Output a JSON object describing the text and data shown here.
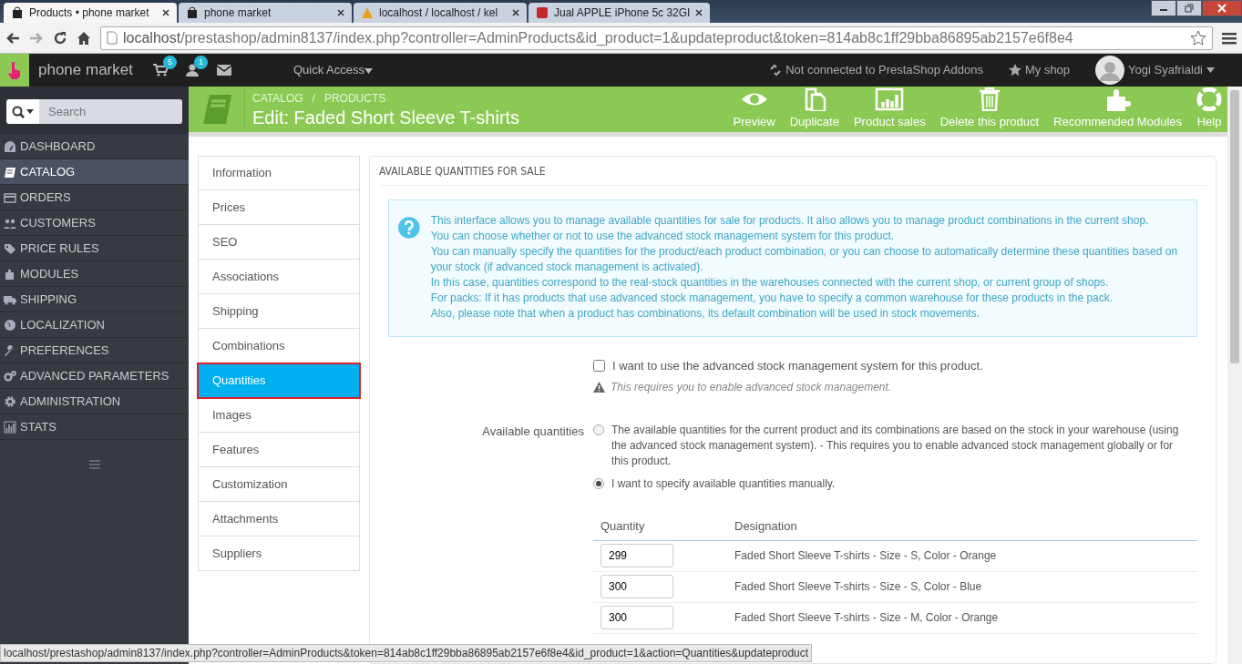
{
  "browser": {
    "tabs": [
      {
        "title": "Products • phone market",
        "selected": true
      },
      {
        "title": "phone market",
        "selected": false
      },
      {
        "title": "localhost / localhost / kel",
        "selected": false
      },
      {
        "title": "Jual APPLE iPhone 5c 32GI",
        "selected": false
      }
    ],
    "url": {
      "host": "localhost",
      "path": "/prestashop/admin8137/index.php?controller=AdminProducts&id_product=1&updateproduct&token=814ab8c1ff29bba86895ab2157e6f8e4"
    }
  },
  "topbar": {
    "brand": "phone market",
    "cart_count": "5",
    "customer_count": "1",
    "quick_access": "Quick Access",
    "addons": "Not connected to PrestaShop Addons",
    "my_shop": "My shop",
    "user": "Yogi Syafrialdi"
  },
  "sidebar": {
    "search_placeholder": "Search",
    "items": [
      {
        "label": "DASHBOARD",
        "selected": false
      },
      {
        "label": "CATALOG",
        "selected": true
      },
      {
        "label": "ORDERS",
        "selected": false
      },
      {
        "label": "CUSTOMERS",
        "selected": false
      },
      {
        "label": "PRICE RULES",
        "selected": false
      },
      {
        "label": "MODULES",
        "selected": false
      },
      {
        "label": "SHIPPING",
        "selected": false
      },
      {
        "label": "LOCALIZATION",
        "selected": false
      },
      {
        "label": "PREFERENCES",
        "selected": false
      },
      {
        "label": "ADVANCED PARAMETERS",
        "selected": false
      },
      {
        "label": "ADMINISTRATION",
        "selected": false
      },
      {
        "label": "STATS",
        "selected": false
      }
    ]
  },
  "header": {
    "breadcrumbs": [
      "CATALOG",
      "PRODUCTS"
    ],
    "breadcrumb_separator": "/",
    "title": "Edit: Faded Short Sleeve T-shirts",
    "actions": [
      "Preview",
      "Duplicate",
      "Product sales",
      "Delete this product",
      "Recommended Modules",
      "Help"
    ]
  },
  "product_tabs": [
    {
      "label": "Information",
      "selected": false
    },
    {
      "label": "Prices",
      "selected": false
    },
    {
      "label": "SEO",
      "selected": false
    },
    {
      "label": "Associations",
      "selected": false
    },
    {
      "label": "Shipping",
      "selected": false
    },
    {
      "label": "Combinations",
      "selected": false
    },
    {
      "label": "Quantities",
      "selected": true
    },
    {
      "label": "Images",
      "selected": false
    },
    {
      "label": "Features",
      "selected": false
    },
    {
      "label": "Customization",
      "selected": false
    },
    {
      "label": "Attachments",
      "selected": false
    },
    {
      "label": "Suppliers",
      "selected": false
    }
  ],
  "panel": {
    "heading": "AVAILABLE QUANTITIES FOR SALE",
    "info_lines": [
      "This interface allows you to manage available quantities for sale for products. It also allows you to manage product combinations in the current shop.",
      "You can choose whether or not to use the advanced stock management system for this product.",
      "You can manually specify the quantities for the product/each product combination, or you can choose to automatically determine these quantities based on your stock (if advanced stock management is activated).",
      "In this case, quantities correspond to the real-stock quantities in the warehouses connected with the current shop, or current group of shops.",
      "For packs: If it has products that use advanced stock management, you have to specify a common warehouse for these products in the pack.",
      "Also, please note that when a product has combinations, its default combination will be used in stock movements."
    ],
    "advanced_stock": {
      "label": "I want to use the advanced stock management system for this product.",
      "checked": false
    },
    "warning": "This requires you to enable advanced stock management.",
    "available_quantities": {
      "label": "Available quantities",
      "options": [
        {
          "label": "The available quantities for the current product and its combinations are based on the stock in your warehouse (using the advanced stock management system).  - This requires you to enable advanced stock management globally or for this product.",
          "selected": false
        },
        {
          "label": "I want to specify available quantities manually.",
          "selected": true
        }
      ]
    },
    "table": {
      "columns": [
        "Quantity",
        "Designation"
      ],
      "rows": [
        {
          "quantity": "299",
          "designation": "Faded Short Sleeve T-shirts - Size - S, Color - Orange"
        },
        {
          "quantity": "300",
          "designation": "Faded Short Sleeve T-shirts - Size - S, Color - Blue"
        },
        {
          "quantity": "300",
          "designation": "Faded Short Sleeve T-shirts - Size - M, Color - Orange"
        }
      ]
    }
  },
  "status_bar": "localhost/prestashop/admin8137/index.php?controller=AdminProducts&token=814ab8c1ff29bba86895ab2157e6f8e4&id_product=1&action=Quantities&updateproduct"
}
